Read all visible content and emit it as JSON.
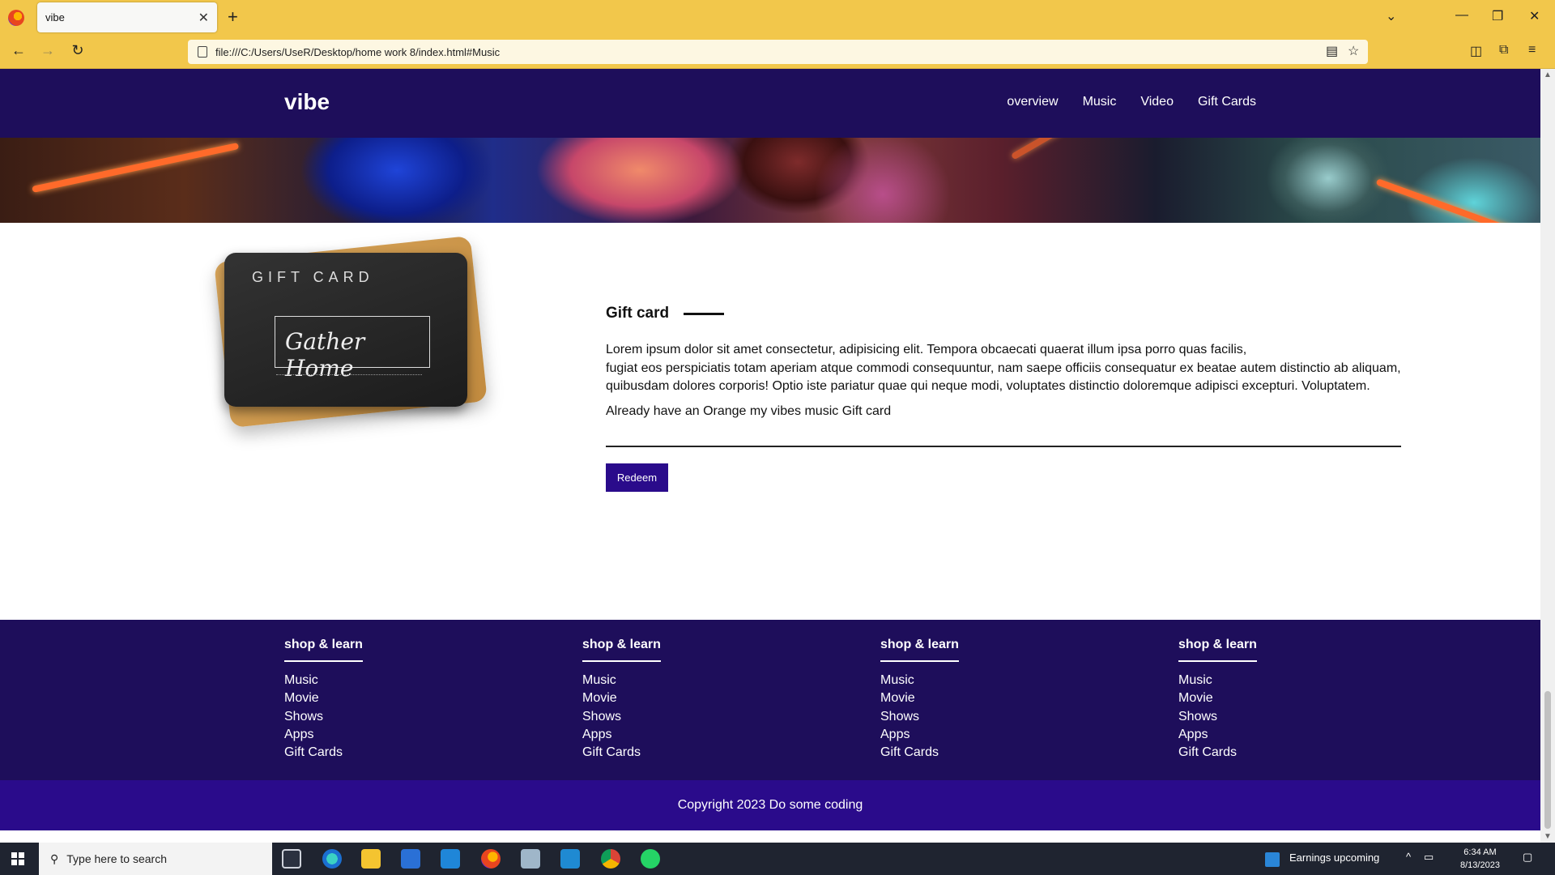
{
  "browser": {
    "tab_title": "vibe",
    "url": "file:///C:/Users/UseR/Desktop/home work 8/index.html#Music"
  },
  "site": {
    "logo": "vibe",
    "nav": [
      "overview",
      "Music",
      "Video",
      "Gift Cards"
    ]
  },
  "card_image": {
    "title": "GIFT CARD",
    "logo_text": "Gather Home"
  },
  "gift": {
    "heading": "Gift card",
    "paragraph_line1": "Lorem ipsum dolor sit amet consectetur, adipisicing elit. Tempora obcaecati quaerat illum ipsa porro quas facilis,",
    "paragraph_line2": "fugiat eos perspiciatis totam aperiam atque commodi consequuntur, nam saepe officiis consequatur ex beatae autem distinctio ab aliquam,",
    "paragraph_line3": "quibusdam dolores corporis! Optio iste pariatur quae qui neque modi, voluptates distinctio doloremque adipisci excepturi. Voluptatem.",
    "already": "Already have an Orange my vibes music Gift card",
    "redeem_label": "Redeem"
  },
  "footer": {
    "columns": [
      {
        "heading": "shop & learn",
        "links": [
          "Music",
          "Movie",
          "Shows",
          "Apps",
          "Gift Cards"
        ]
      },
      {
        "heading": "shop & learn",
        "links": [
          "Music",
          "Movie",
          "Shows",
          "Apps",
          "Gift Cards"
        ]
      },
      {
        "heading": "shop & learn",
        "links": [
          "Music",
          "Movie",
          "Shows",
          "Apps",
          "Gift Cards"
        ]
      },
      {
        "heading": "shop & learn",
        "links": [
          "Music",
          "Movie",
          "Shows",
          "Apps",
          "Gift Cards"
        ]
      }
    ],
    "copyright": "Copyright 2023 Do some coding"
  },
  "taskbar": {
    "search_placeholder": "Type here to search",
    "news": "Earnings upcoming",
    "time": "6:34 AM",
    "date": "8/13/2023"
  },
  "colors": {
    "header_bg": "#1e0e5b",
    "accent": "#2a0b8b",
    "browser_chrome": "#f2c74b"
  }
}
